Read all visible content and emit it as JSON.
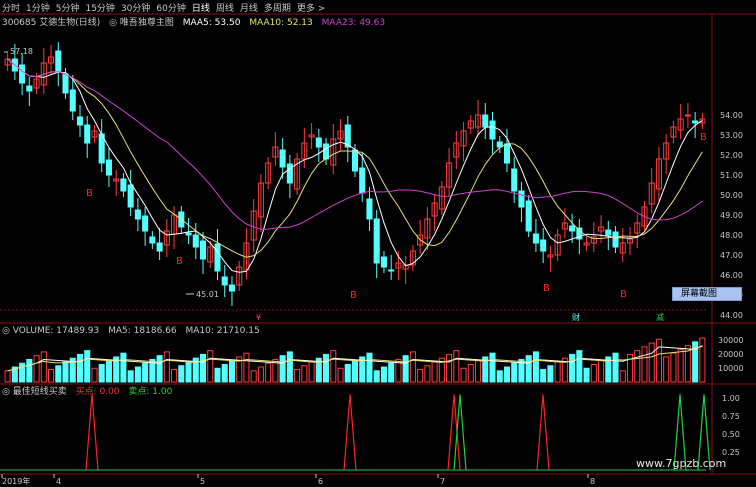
{
  "tabs": [
    "分时",
    "1分钟",
    "5分钟",
    "15分钟",
    "30分钟",
    "60分钟",
    "日线",
    "周线",
    "月线",
    "多周期",
    "更多 >"
  ],
  "active_tab": "日线",
  "main_info": {
    "stock": "300685 艾德生物(日线)",
    "indicator": "◎ 唯吾独尊主图",
    "maa5": "MAA5: 53.50",
    "maa10": "MAA10: 52.13",
    "maa23": "MAA23: 49.63"
  },
  "volume_info": {
    "title": "◎ VOLUME: 17489.93",
    "ma5": "MA5: 18186.66",
    "ma10": "MA10: 21710.15"
  },
  "signal_info": {
    "title": "◎ 最佳短线买卖",
    "buy": "买点: 0.00",
    "sell": "卖点: 1.00"
  },
  "price_labels": [
    "54.00",
    "53.00",
    "52.00",
    "51.00",
    "50.00",
    "49.00",
    "48.00",
    "47.00",
    "46.00",
    "45.00",
    "44.00"
  ],
  "volume_labels": [
    "30000",
    "20000",
    "10000"
  ],
  "signal_labels": [
    "1.00",
    "0.75",
    "0.50",
    "0.25"
  ],
  "annotations": {
    "high": "57.18",
    "low": "45.01"
  },
  "buy_marks": [
    "B",
    "B",
    "B",
    "B",
    "B",
    "B"
  ],
  "event_marks": [
    "¥",
    "财",
    "减"
  ],
  "date_labels": [
    "2019年",
    "4",
    "5",
    "6",
    "7",
    "8"
  ],
  "screenshot_button": {
    "label": "屏幕截图",
    "value": "35"
  },
  "watermark": "www.7gpzb.com",
  "colors": {
    "up": "#ff3c3c",
    "down": "#54ffff",
    "ma5": "#ffffff",
    "ma10": "#e8e070",
    "ma23": "#d040d0",
    "buy": "#ff2020",
    "sell": "#20d040"
  }
}
